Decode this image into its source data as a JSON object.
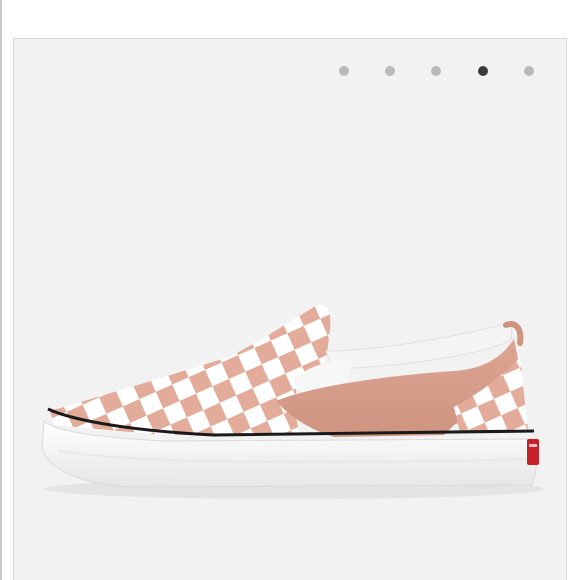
{
  "gallery": {
    "slide_count": 5,
    "active_slide": 4,
    "dot_color": "#b9b9b9",
    "active_dot_color": "#3b3b3b",
    "background_color": "#f2f2f2"
  },
  "product_image": {
    "icon": "slip-on-sneaker-image",
    "accent_color": "#d9a08c",
    "checker_color": "#e3ab99",
    "sole_color": "#f7f7f7",
    "stripe_color": "#1a1a1a",
    "heel_tab_color": "#c8202a"
  }
}
